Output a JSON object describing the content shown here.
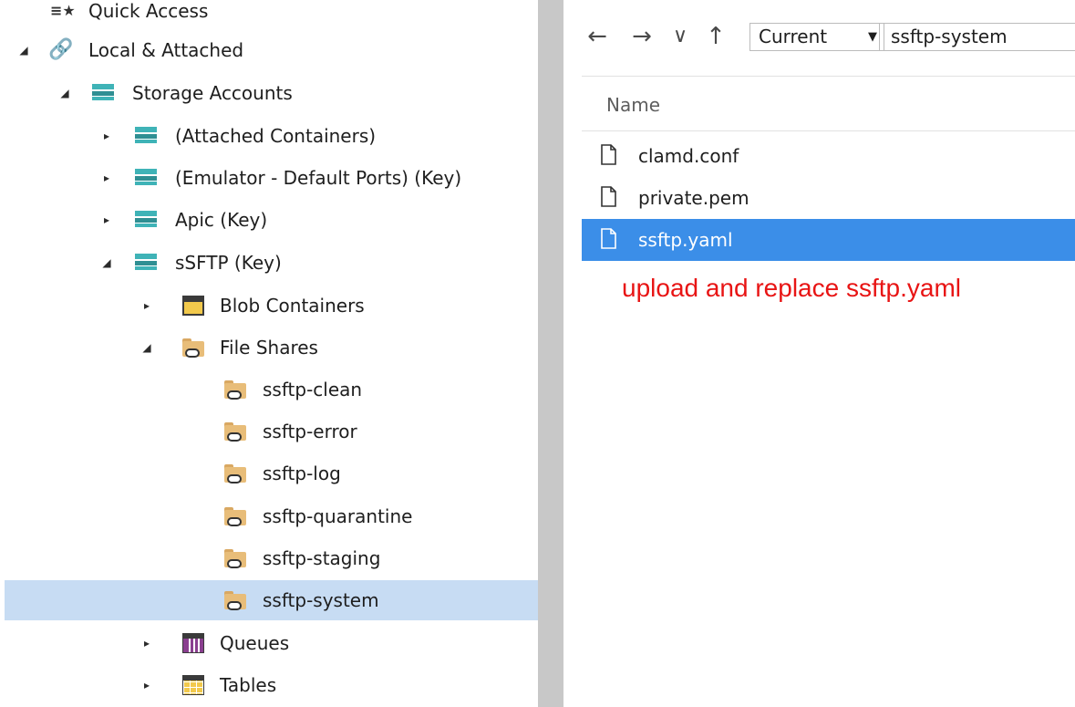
{
  "tree": {
    "quick_access": "Quick Access",
    "local_attached": "Local & Attached",
    "storage_accounts": "Storage Accounts",
    "attached_containers": "(Attached Containers)",
    "emulator": "(Emulator - Default Ports) (Key)",
    "apic": "Apic (Key)",
    "ssftp": "sSFTP (Key)",
    "blob_containers": "Blob Containers",
    "file_shares": "File Shares",
    "shares": [
      "ssftp-clean",
      "ssftp-error",
      "ssftp-log",
      "ssftp-quarantine",
      "ssftp-staging",
      "ssftp-system"
    ],
    "queues": "Queues",
    "tables": "Tables"
  },
  "pane": {
    "back_icon": "←",
    "forward_icon": "→",
    "recent_icon": "∨",
    "up_icon": "↑",
    "account_select": "Current",
    "account_select_arrow": "▼",
    "path": "ssftp-system",
    "column_name": "Name",
    "files": [
      "clamd.conf",
      "private.pem",
      "ssftp.yaml"
    ],
    "note": "upload and replace ssftp.yaml"
  },
  "colors": {
    "selected_tree": "#c7dcf3",
    "selected_file": "#3b8ee8",
    "note": "#e81414",
    "splitter": "#c8c8c8"
  }
}
